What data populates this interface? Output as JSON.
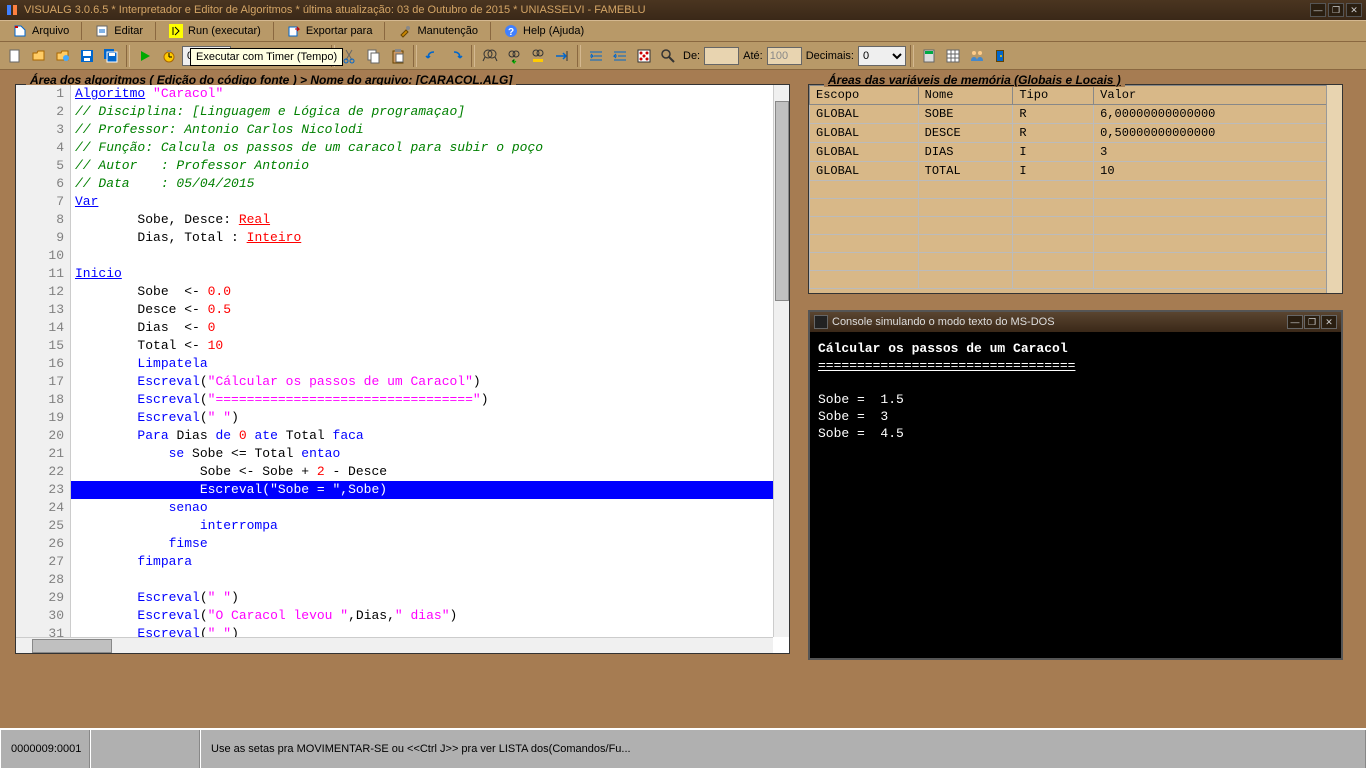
{
  "titlebar": {
    "text": "VISUALG 3.0.6.5 * Interpretador e Editor de Algoritmos * última atualização: 03 de Outubro de 2015 * UNIASSELVI - FAMEBLU"
  },
  "menus": {
    "arquivo": "Arquivo",
    "editar": "Editar",
    "run": "Run (executar)",
    "exportar": "Exportar para",
    "manutencao": "Manutenção",
    "help": "Help (Ajuda)"
  },
  "toolbar": {
    "timer_value": "0,05s",
    "de_label": "De:",
    "de_value": "",
    "ate_label": "Até:",
    "ate_value": "100",
    "decimais_label": "Decimais:",
    "decimais_value": "0",
    "tooltip": "Executar com Timer (Tempo)"
  },
  "code_panel": {
    "header": "Área dos algoritmos ( Edição do código fonte )   > Nome do arquivo: [CARACOL.ALG]"
  },
  "code_lines": [
    {
      "n": 1,
      "tokens": [
        {
          "t": "kw-u",
          "v": "Algoritmo"
        },
        {
          "t": "",
          "v": " "
        },
        {
          "t": "str",
          "v": "\"Caracol\""
        }
      ]
    },
    {
      "n": 2,
      "tokens": [
        {
          "t": "cmt",
          "v": "// Disciplina: [Linguagem e Lógica de programaçao]"
        }
      ]
    },
    {
      "n": 3,
      "tokens": [
        {
          "t": "cmt",
          "v": "// Professor: Antonio Carlos Nicolodi"
        }
      ]
    },
    {
      "n": 4,
      "tokens": [
        {
          "t": "cmt",
          "v": "// Função: Calcula os passos de um caracol para subir o poço"
        }
      ]
    },
    {
      "n": 5,
      "tokens": [
        {
          "t": "cmt",
          "v": "// Autor   : Professor Antonio"
        }
      ]
    },
    {
      "n": 6,
      "tokens": [
        {
          "t": "cmt",
          "v": "// Data    : 05/04/2015"
        }
      ]
    },
    {
      "n": 7,
      "tokens": [
        {
          "t": "kw-u",
          "v": "Var"
        }
      ]
    },
    {
      "n": 8,
      "tokens": [
        {
          "t": "",
          "v": "        Sobe, Desce: "
        },
        {
          "t": "type",
          "v": "Real"
        }
      ]
    },
    {
      "n": 9,
      "tokens": [
        {
          "t": "",
          "v": "        Dias, Total : "
        },
        {
          "t": "type",
          "v": "Inteiro"
        }
      ]
    },
    {
      "n": 10,
      "tokens": []
    },
    {
      "n": 11,
      "tokens": [
        {
          "t": "kw-u",
          "v": "Inicio"
        }
      ]
    },
    {
      "n": 12,
      "tokens": [
        {
          "t": "",
          "v": "        Sobe  <- "
        },
        {
          "t": "num",
          "v": "0.0"
        }
      ]
    },
    {
      "n": 13,
      "tokens": [
        {
          "t": "",
          "v": "        Desce <- "
        },
        {
          "t": "num",
          "v": "0.5"
        }
      ]
    },
    {
      "n": 14,
      "tokens": [
        {
          "t": "",
          "v": "        Dias  <- "
        },
        {
          "t": "num",
          "v": "0"
        }
      ]
    },
    {
      "n": 15,
      "tokens": [
        {
          "t": "",
          "v": "        Total <- "
        },
        {
          "t": "num",
          "v": "10"
        }
      ]
    },
    {
      "n": 16,
      "tokens": [
        {
          "t": "",
          "v": "        "
        },
        {
          "t": "kw",
          "v": "Limpatela"
        }
      ]
    },
    {
      "n": 17,
      "tokens": [
        {
          "t": "",
          "v": "        "
        },
        {
          "t": "kw",
          "v": "Escreval"
        },
        {
          "t": "",
          "v": "("
        },
        {
          "t": "str",
          "v": "\"Cálcular os passos de um Caracol\""
        },
        {
          "t": "",
          "v": ")"
        }
      ]
    },
    {
      "n": 18,
      "tokens": [
        {
          "t": "",
          "v": "        "
        },
        {
          "t": "kw",
          "v": "Escreval"
        },
        {
          "t": "",
          "v": "("
        },
        {
          "t": "str",
          "v": "\"=================================\""
        },
        {
          "t": "",
          "v": ")"
        }
      ]
    },
    {
      "n": 19,
      "tokens": [
        {
          "t": "",
          "v": "        "
        },
        {
          "t": "kw",
          "v": "Escreval"
        },
        {
          "t": "",
          "v": "("
        },
        {
          "t": "str",
          "v": "\" \""
        },
        {
          "t": "",
          "v": ")"
        }
      ]
    },
    {
      "n": 20,
      "tokens": [
        {
          "t": "",
          "v": "        "
        },
        {
          "t": "kw",
          "v": "Para"
        },
        {
          "t": "",
          "v": " Dias "
        },
        {
          "t": "kw",
          "v": "de"
        },
        {
          "t": "",
          "v": " "
        },
        {
          "t": "num",
          "v": "0"
        },
        {
          "t": "",
          "v": " "
        },
        {
          "t": "kw",
          "v": "ate"
        },
        {
          "t": "",
          "v": " Total "
        },
        {
          "t": "kw",
          "v": "faca"
        }
      ]
    },
    {
      "n": 21,
      "tokens": [
        {
          "t": "",
          "v": "            "
        },
        {
          "t": "kw",
          "v": "se"
        },
        {
          "t": "",
          "v": " Sobe <= Total "
        },
        {
          "t": "kw",
          "v": "entao"
        }
      ]
    },
    {
      "n": 22,
      "tokens": [
        {
          "t": "",
          "v": "                Sobe <- Sobe + "
        },
        {
          "t": "num",
          "v": "2"
        },
        {
          "t": "",
          "v": " - Desce"
        }
      ]
    },
    {
      "n": 23,
      "hl": true,
      "tokens": [
        {
          "t": "",
          "v": "                "
        },
        {
          "t": "kw",
          "v": "Escreval"
        },
        {
          "t": "",
          "v": "("
        },
        {
          "t": "str",
          "v": "\"Sobe = \""
        },
        {
          "t": "",
          "v": ",Sobe)"
        }
      ]
    },
    {
      "n": 24,
      "tokens": [
        {
          "t": "",
          "v": "            "
        },
        {
          "t": "kw",
          "v": "senao"
        }
      ]
    },
    {
      "n": 25,
      "tokens": [
        {
          "t": "",
          "v": "                "
        },
        {
          "t": "kw",
          "v": "interrompa"
        }
      ]
    },
    {
      "n": 26,
      "tokens": [
        {
          "t": "",
          "v": "            "
        },
        {
          "t": "kw",
          "v": "fimse"
        }
      ]
    },
    {
      "n": 27,
      "tokens": [
        {
          "t": "",
          "v": "        "
        },
        {
          "t": "kw",
          "v": "fimpara"
        }
      ]
    },
    {
      "n": 28,
      "tokens": []
    },
    {
      "n": 29,
      "tokens": [
        {
          "t": "",
          "v": "        "
        },
        {
          "t": "kw",
          "v": "Escreval"
        },
        {
          "t": "",
          "v": "("
        },
        {
          "t": "str",
          "v": "\" \""
        },
        {
          "t": "",
          "v": ")"
        }
      ]
    },
    {
      "n": 30,
      "tokens": [
        {
          "t": "",
          "v": "        "
        },
        {
          "t": "kw",
          "v": "Escreval"
        },
        {
          "t": "",
          "v": "("
        },
        {
          "t": "str",
          "v": "\"O Caracol levou \""
        },
        {
          "t": "",
          "v": ",Dias,"
        },
        {
          "t": "str",
          "v": "\" dias\""
        },
        {
          "t": "",
          "v": ")"
        }
      ]
    },
    {
      "n": 31,
      "tokens": [
        {
          "t": "",
          "v": "        "
        },
        {
          "t": "kw",
          "v": "Escreval"
        },
        {
          "t": "",
          "v": "("
        },
        {
          "t": "str",
          "v": "\" \""
        },
        {
          "t": "",
          "v": ")"
        }
      ]
    }
  ],
  "vars_panel": {
    "header": "Áreas das variáveis de memória (Globais e Locais )",
    "columns": [
      "Escopo",
      "Nome",
      "Tipo",
      "Valor"
    ],
    "rows": [
      {
        "escopo": "GLOBAL",
        "nome": "SOBE",
        "tipo": "R",
        "valor": "6,00000000000000"
      },
      {
        "escopo": "GLOBAL",
        "nome": "DESCE",
        "tipo": "R",
        "valor": "0,50000000000000"
      },
      {
        "escopo": "GLOBAL",
        "nome": "DIAS",
        "tipo": "I",
        "valor": "3"
      },
      {
        "escopo": "GLOBAL",
        "nome": "TOTAL",
        "tipo": "I",
        "valor": "10"
      }
    ]
  },
  "console": {
    "title": "Console simulando o modo texto do MS-DOS",
    "lines": [
      {
        "text": "Cálcular os passos de um Caracol",
        "bold": true
      },
      {
        "text": "=================================",
        "uline": true
      },
      {
        "text": " "
      },
      {
        "text": "Sobe =  1.5"
      },
      {
        "text": "Sobe =  3"
      },
      {
        "text": "Sobe =  4.5"
      }
    ]
  },
  "statusbar": {
    "position": "0000009:0001",
    "hint": "Use as setas pra MOVIMENTAR-SE ou <<Ctrl J>> pra ver LISTA dos(Comandos/Fu..."
  }
}
